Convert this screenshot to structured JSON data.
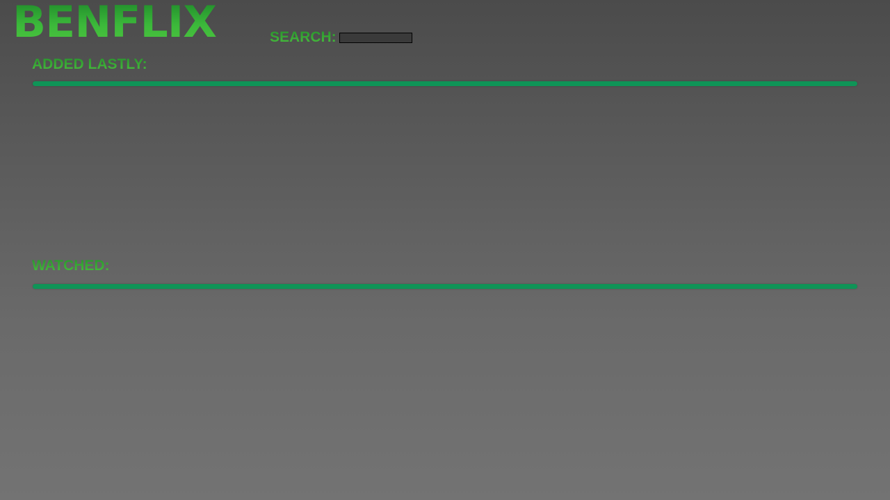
{
  "brand": {
    "logo_text": "BENFLIX",
    "accent_color": "#3bb83a",
    "divider_color": "#0f9457"
  },
  "search": {
    "label": "SEARCH:",
    "value": "",
    "placeholder": ""
  },
  "sections": [
    {
      "title": "ADDED LASTLY:",
      "items": []
    },
    {
      "title": "WATCHED:",
      "items": []
    }
  ]
}
